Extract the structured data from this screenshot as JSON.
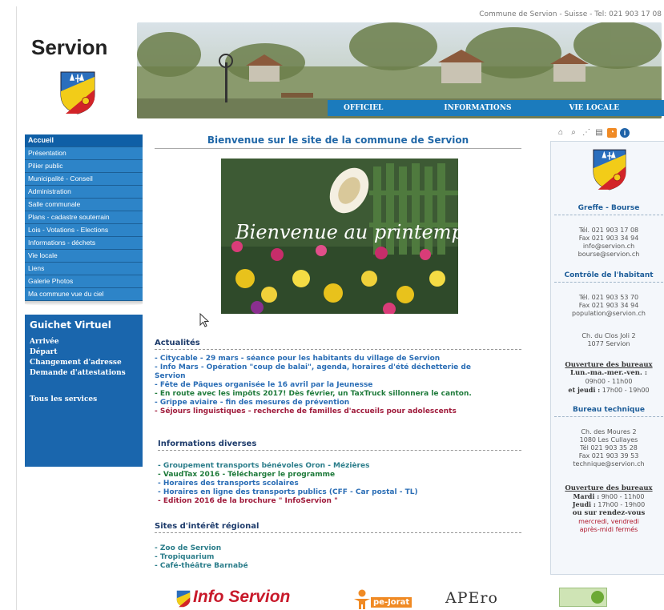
{
  "header": {
    "topline": "Commune de Servion - Suisse - Tel: 021 903 17 08",
    "site_name": "Servion",
    "nav": [
      {
        "label": "OFFICIEL"
      },
      {
        "label": "INFORMATIONS"
      },
      {
        "label": "VIE LOCALE"
      }
    ]
  },
  "leftnav": {
    "items": [
      {
        "label": "Accueil",
        "active": true
      },
      {
        "label": "Présentation"
      },
      {
        "label": "Pilier public"
      },
      {
        "label": "Municipalité - Conseil"
      },
      {
        "label": "Administration"
      },
      {
        "label": "Salle communale"
      },
      {
        "label": "Plans - cadastre souterrain"
      },
      {
        "label": "Lois - Votations - Elections"
      },
      {
        "label": "Informations - déchets"
      },
      {
        "label": "Vie locale"
      },
      {
        "label": "Liens"
      },
      {
        "label": "Galerie Photos"
      },
      {
        "label": "Ma commune vue du ciel"
      }
    ]
  },
  "guichet": {
    "title": "Guichet Virtuel",
    "links": [
      "Arrivée",
      "Départ",
      "Changement d'adresse",
      "Demande d'attestations"
    ],
    "all_services": "Tous les services"
  },
  "main": {
    "welcome": "Bienvenue sur le site de la commune de Servion",
    "hero_caption": "Bienvenue au printemps !",
    "actualites": {
      "title": "Actualités",
      "items": [
        {
          "text": "- Citycable - 29 mars - séance pour les habitants du village de Servion",
          "color": "blue"
        },
        {
          "text": "- Info Mars - Opération \"coup de balai\", agenda, horaires d'été déchetterie de",
          "color": "blue"
        },
        {
          "text": "Servion",
          "color": "blue"
        },
        {
          "text": "- Fête de Pâques organisée le 16 avril par la Jeunesse",
          "color": "blue"
        },
        {
          "text": "- En route avec les impôts 2017! Dès février, un TaxTruck sillonnera le canton.",
          "color": "green"
        },
        {
          "text": "- Grippe aviaire - fin des mesures de prévention",
          "color": "blue"
        },
        {
          "text": "- Séjours linguistiques - recherche de familles d'accueils pour adolescents",
          "color": "red"
        }
      ]
    },
    "infos": {
      "title": "Informations diverses",
      "items": [
        {
          "text": "- Groupement transports bénévoles Oron - Mézières",
          "color": "teal"
        },
        {
          "text": "- VaudTax 2016 - Télécharger le programme",
          "color": "green"
        },
        {
          "text": "- Horaires des transports scolaires",
          "color": "blue"
        },
        {
          "text": "- Horaires en ligne des transports publics (CFF - Car postal - TL)",
          "color": "blue"
        },
        {
          "text": "- Edition 2016 de la brochure \" InfoServion \"",
          "color": "red"
        }
      ]
    },
    "sites": {
      "title": "Sites d'intérêt régional",
      "items": [
        {
          "text": "- Zoo de Servion",
          "color": "teal"
        },
        {
          "text": "- Tropiquarium",
          "color": "teal"
        },
        {
          "text": "- Café-théâtre Barnabé",
          "color": "teal"
        }
      ]
    }
  },
  "right": {
    "greffe": {
      "title": "Greffe - Bourse",
      "lines": [
        "Tél. 021 903 17 08",
        "Fax 021 903 34 94",
        "info@servion.ch",
        "bourse@servion.ch"
      ]
    },
    "controle": {
      "title": "Contrôle de l'habitant",
      "lines": [
        "Tél. 021 903 53 70",
        "Fax 021 903 34 94",
        "population@servion.ch"
      ],
      "address": [
        "Ch. du Clos Joli 2",
        "1077 Servion"
      ]
    },
    "ouverture1": {
      "title": "Ouverture des bureaux",
      "line1": "Lun.-ma.-mer.-ven. :",
      "line2": "09h00 - 11h00",
      "line3_bold": "et jeudi :",
      "line3": "17h00 - 19h00"
    },
    "technique": {
      "title": "Bureau technique",
      "lines": [
        "Ch. des Moures 2",
        "1080 Les Cullayes",
        "Tél 021 903 35 28",
        "Fax 021 903 39 53",
        "technique@servion.ch"
      ]
    },
    "ouverture2": {
      "title": "Ouverture des bureaux",
      "mardi_label": "Mardi :",
      "mardi": "9h00 - 11h00",
      "jeudi_label": "Jeudi :",
      "jeudi": "17h00 - 19h00",
      "rdv": "ou sur rendez-vous",
      "closed1": "mercredi, vendredi",
      "closed2": "après-midi fermés"
    }
  },
  "footer": {
    "logo1": "Info Servion",
    "logo2": "pe-Jorat",
    "logo3": "APEro"
  },
  "colors": {
    "nav_blue": "#1b7bbd",
    "left_nav": "#2d84c8",
    "guichet": "#1a66ad",
    "title_blue": "#2168a8"
  }
}
